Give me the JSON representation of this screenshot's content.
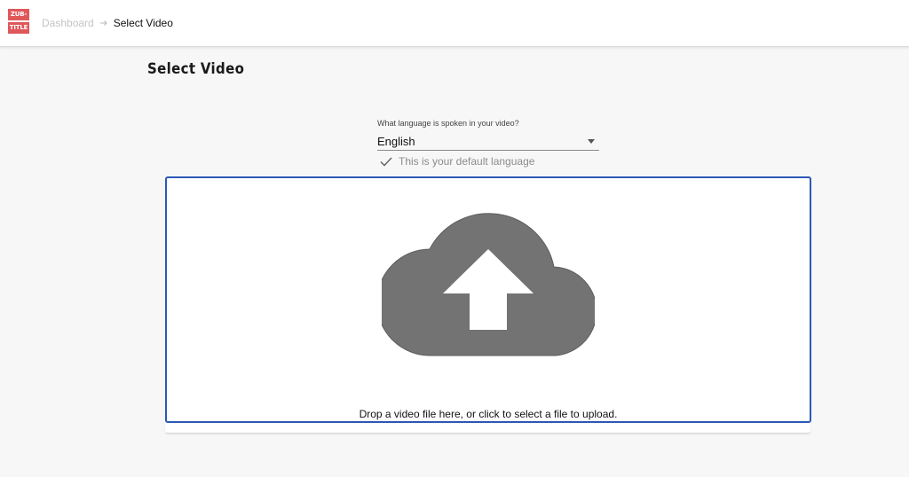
{
  "header": {
    "logo": {
      "line1": "ZUB-",
      "line2": "TITLE",
      "color": "#e0575a"
    },
    "breadcrumb": {
      "home": "Dashboard",
      "separator_icon": "arrow-right-icon",
      "current": "Select Video"
    }
  },
  "page": {
    "title": "Select Video"
  },
  "language": {
    "label": "What language is spoken in your video?",
    "value": "English",
    "default_icon": "check-icon",
    "default_note": "This is your default language"
  },
  "dropzone": {
    "icon": "cloud-upload-icon",
    "text": "Drop a video file here, or click to select a file to upload.",
    "border_color": "#2c58b6"
  }
}
